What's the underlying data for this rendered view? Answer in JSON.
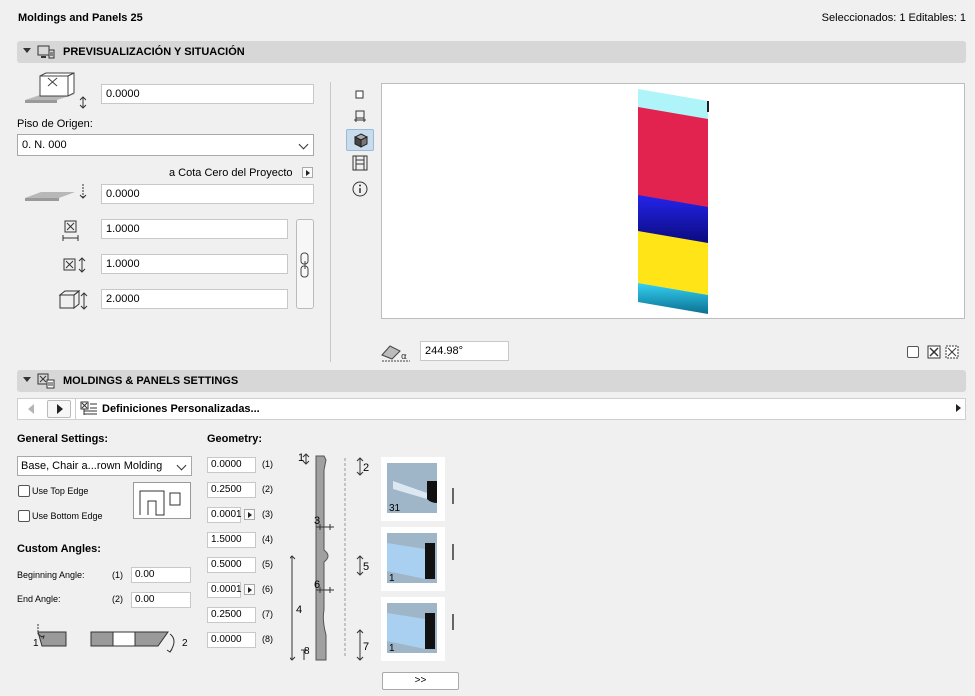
{
  "header": {
    "title": "Moldings and Panels 25",
    "selection_status": "Seleccionados: 1 Editables: 1"
  },
  "section1": {
    "title": "PREVISUALIZACIÓN Y SITUACIÓN"
  },
  "placement": {
    "elevation_value": "0.0000",
    "home_story_label": "Piso de Origen:",
    "home_story_value": "0. N. 000",
    "reference_label": "a Cota Cero del Proyecto",
    "reference_value": "0.0000",
    "width_value": "1.0000",
    "depth_value": "1.0000",
    "height_value": "2.0000"
  },
  "preview": {
    "angle_value": "244.98°",
    "stripes": [
      {
        "color": "#aef4f8"
      },
      {
        "color": "#e2234f"
      },
      {
        "color": "#1c1ad8"
      },
      {
        "color": "#ffe518"
      },
      {
        "color": "#20b7de"
      }
    ]
  },
  "section2": {
    "title": "MOLDINGS & PANELS SETTINGS"
  },
  "nav": {
    "settings_page_label": "Definiciones Personalizadas..."
  },
  "general": {
    "title": "General Settings:",
    "type_value": "Base, Chair a...rown Molding",
    "use_top_edge": "Use Top Edge",
    "use_bottom_edge": "Use Bottom Edge"
  },
  "angles": {
    "title": "Custom Angles:",
    "beginning_label": "Beginning Angle:",
    "beginning_index": "(1)",
    "beginning_value": "0.00",
    "end_label": "End Angle:",
    "end_index": "(2)",
    "end_value": "0.00",
    "diagram_label_1": "1",
    "diagram_label_2": "2"
  },
  "geometry": {
    "title": "Geometry:",
    "rows": [
      {
        "value": "0.0000",
        "index": "(1)"
      },
      {
        "value": "0.2500",
        "index": "(2)"
      },
      {
        "value": "0.0001",
        "index": "(3)"
      },
      {
        "value": "1.5000",
        "index": "(4)"
      },
      {
        "value": "0.5000",
        "index": "(5)"
      },
      {
        "value": "0.0001",
        "index": "(6)"
      },
      {
        "value": "0.2500",
        "index": "(7)"
      },
      {
        "value": "0.0000",
        "index": "(8)"
      }
    ],
    "profile_labels": [
      "1",
      "2",
      "3",
      "4",
      "5",
      "6",
      "7",
      "8"
    ]
  },
  "thumbnails": [
    {
      "badge": "31"
    },
    {
      "badge": "1"
    },
    {
      "badge": "1"
    }
  ],
  "more_button_label": ">>"
}
